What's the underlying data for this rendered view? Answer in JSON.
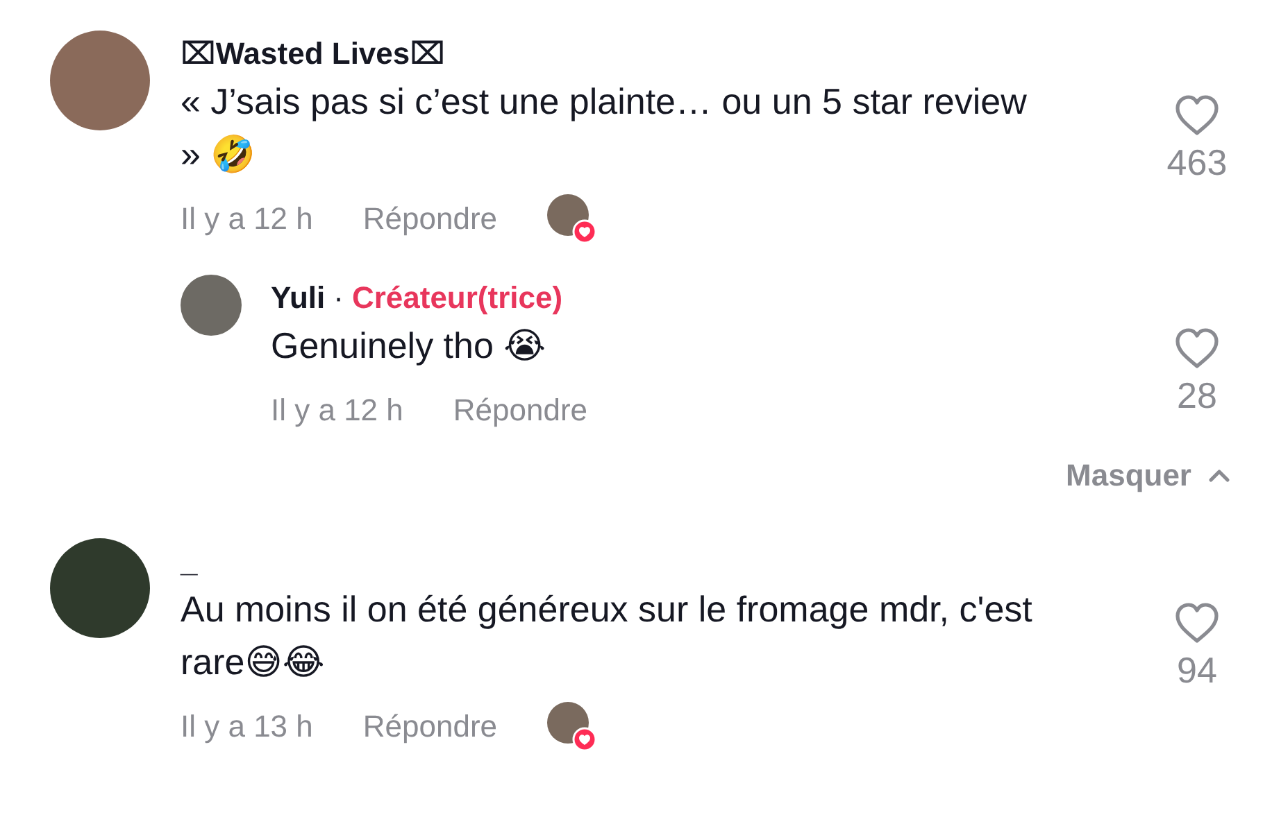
{
  "comments": [
    {
      "author": "⌧Wasted Lives⌧",
      "text": "« J’sais pas si c’est une plainte… ou un 5 star review » 🤣",
      "time": "Il y a 12 h",
      "reply_label": "Répondre",
      "likes": "463",
      "liked": false,
      "creator_liked": true,
      "replies": [
        {
          "author": "Yuli",
          "badge": {
            "separator": "·",
            "label": "Créateur(trice)"
          },
          "text": "Genuinely tho 😭",
          "time": "Il y a 12 h",
          "reply_label": "Répondre",
          "likes": "28",
          "liked": false
        }
      ],
      "replies_toggle": {
        "label": "Masquer",
        "expanded": true
      }
    },
    {
      "author": "_",
      "text": "Au moins il on été généreux sur le fromage mdr, c'est rare😅😂",
      "time": "Il y a 13 h",
      "reply_label": "Répondre",
      "likes": "94",
      "liked": false,
      "creator_liked": true
    }
  ]
}
